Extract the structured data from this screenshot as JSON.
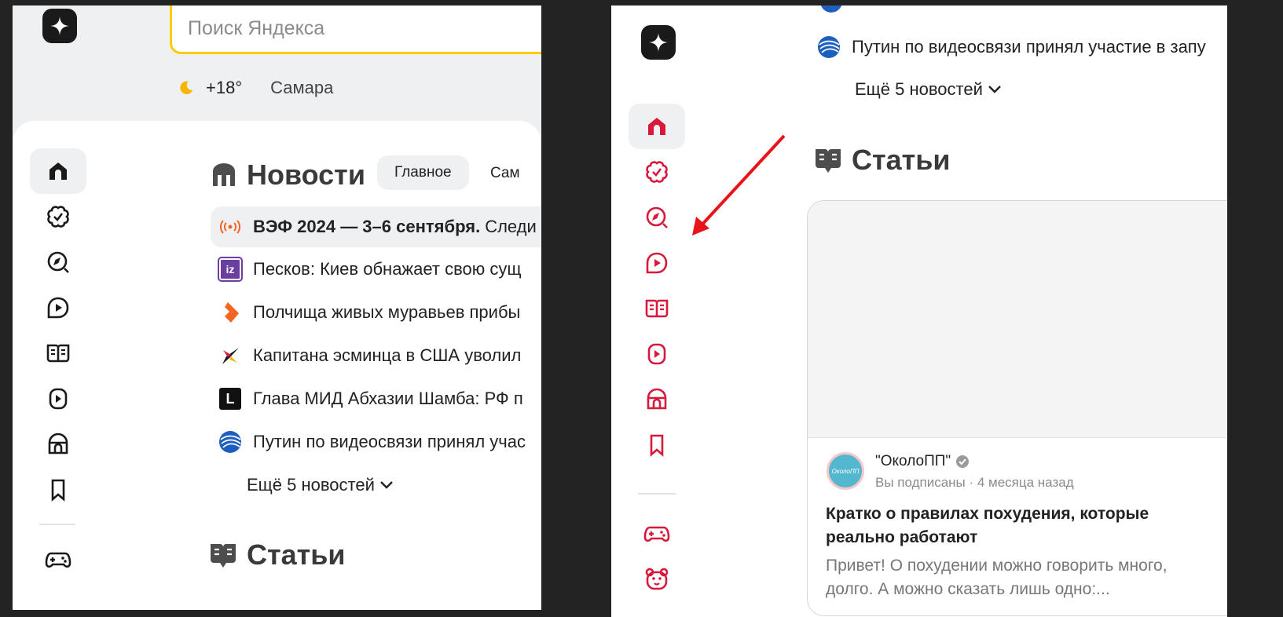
{
  "left": {
    "search": {
      "placeholder": "Поиск Яндекса"
    },
    "weather": {
      "icon": "moon-icon",
      "temperature": "+18°",
      "city": "Самара"
    },
    "news": {
      "title": "Новости",
      "tabs": [
        {
          "label": "Главное",
          "active": true
        },
        {
          "label": "Сам"
        }
      ],
      "items": [
        {
          "source_icon": "live-broadcast-icon",
          "bold": "ВЭФ 2024 — 3–6 сентября.",
          "text": "Следи",
          "highlighted": true
        },
        {
          "source_icon": "izvestia-logo-icon",
          "bold": "",
          "text": "Песков: Киев обнажает свою сущ"
        },
        {
          "source_icon": "ren-tv-logo-icon",
          "bold": "",
          "text": "Полчища живых муравьев прибы"
        },
        {
          "source_icon": "swallow-logo-icon",
          "bold": "",
          "text": "Капитана эсминца в США уволил"
        },
        {
          "source_icon": "lenta-logo-icon",
          "bold": "",
          "text": "Глава МИД Абхазии Шамба: РФ п"
        },
        {
          "source_icon": "globe-logo-icon",
          "bold": "",
          "text": "Путин по видеосвязи принял учас"
        }
      ],
      "more": "Ещё 5 новостей"
    },
    "articles": {
      "title": "Статьи"
    },
    "lenta_letter": "L",
    "izvestia_letters": "iz"
  },
  "right": {
    "news": {
      "last_item": "Путин по видеосвязи принял участие в запу",
      "more": "Ещё 5 новостей"
    },
    "articles": {
      "title": "Статьи",
      "card": {
        "avatar_text": "ОколоПП",
        "author": "\"ОколоПП\"",
        "meta": "Вы подписаны · 4 месяца назад",
        "title": "Кратко о правилах похудения, которые реально работают",
        "excerpt": "Привет! О похудении можно говорить много, долго. А можно сказать лишь одно:..."
      }
    }
  },
  "colors": {
    "nav_icon_left": "#1a1a1a",
    "nav_icon_right": "#d8193c",
    "search_border": "#ffcc00",
    "annotation_arrow": "#e8131b"
  }
}
